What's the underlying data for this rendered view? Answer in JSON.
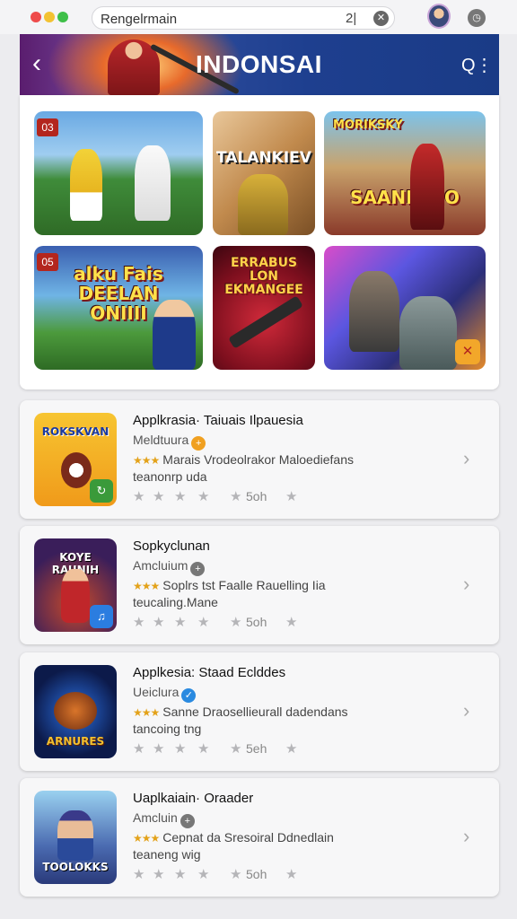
{
  "browser": {
    "url_text": "Rengelrmain",
    "count": "2|",
    "clear_glyph": "✕",
    "clock_glyph": "◷"
  },
  "header": {
    "back_glyph": "‹",
    "title": "INDONSAI",
    "search_glyph": "Q⋮"
  },
  "grid": {
    "tiles": [
      {
        "badge": "03",
        "label": ""
      },
      {
        "badge": "",
        "label": "TALANKIEV"
      },
      {
        "badge": "",
        "label": "SAANMAIO"
      },
      {
        "badge": "05",
        "label": "alku Fais DEELAN ONIIII"
      },
      {
        "badge": "",
        "label": "ERRABUS LON EKMANGEE"
      },
      {
        "badge": "",
        "label": ""
      }
    ],
    "tile3_top": "MORIKSKY"
  },
  "apps": [
    {
      "icon_label": "ROKSKVAN",
      "title": "Applkrasia· Taiuais Ilpauesia",
      "subtitle": "Meldtuura",
      "subtitle_mark": "+",
      "desc": "Marais Vrodeolrakor Maloediefans",
      "desc2": "teanonrp uda",
      "rating_count": "5oh"
    },
    {
      "icon_label": "KOYE RAUNIH",
      "title": "Sopkyclunan",
      "subtitle": "Amcluium",
      "subtitle_mark": "+",
      "desc": "Soplrs tst Faalle Rauelling Iia",
      "desc2": "teucaling.Mane",
      "rating_count": "5oh"
    },
    {
      "icon_label": "ARNURES",
      "title": "Applkesia: Staad Eclddes",
      "subtitle": "Ueiclura",
      "subtitle_mark": "✓",
      "desc": "Sanne Draosellieurall dadendans",
      "desc2": "tancoing tng",
      "rating_count": "5eh"
    },
    {
      "icon_label": "TOOLOKKS",
      "title": "Uaplkaiain· Oraader",
      "subtitle": "Amcluin",
      "subtitle_mark": "+",
      "desc": "Cepnat da Sresoiral Ddnedlain",
      "desc2": "teaneng wig",
      "rating_count": "5oh"
    }
  ],
  "stars_glyph": "★",
  "chevron_glyph": "›"
}
